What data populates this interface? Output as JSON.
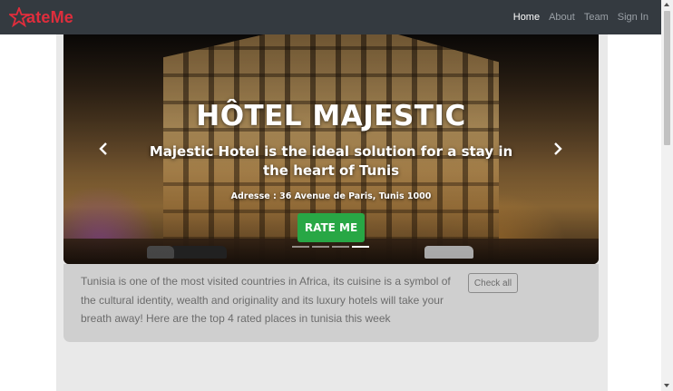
{
  "brand": {
    "name": "ateMe",
    "logo_letter": "R",
    "color": "#e02d3c"
  },
  "nav": {
    "items": [
      {
        "label": "Home",
        "active": true
      },
      {
        "label": "About",
        "active": false
      },
      {
        "label": "Team",
        "active": false
      },
      {
        "label": "Sign In",
        "active": false
      }
    ]
  },
  "carousel": {
    "title": "HÔTEL MAJESTIC",
    "subtitle": "Majestic Hotel is the ideal solution for a stay in the heart of Tunis",
    "address": "Adresse : 36 Avenue de Paris, Tunis 1000",
    "button_label": "RATE ME",
    "prev_icon": "chevron-left-icon",
    "next_icon": "chevron-right-icon",
    "slide_count": 4,
    "active_slide": 4
  },
  "intro": {
    "text": "Tunisia is one of the most visited countries in Africa, its cuisine is a symbol of the cultural identity, wealth and originality and its luxury hotels will take your breath away! Here are the top 4 rated places in tunisia this week",
    "button_label": "Check all"
  },
  "colors": {
    "navbar": "#343a40",
    "accent": "#28a745",
    "panel": "#cfcfcf"
  }
}
